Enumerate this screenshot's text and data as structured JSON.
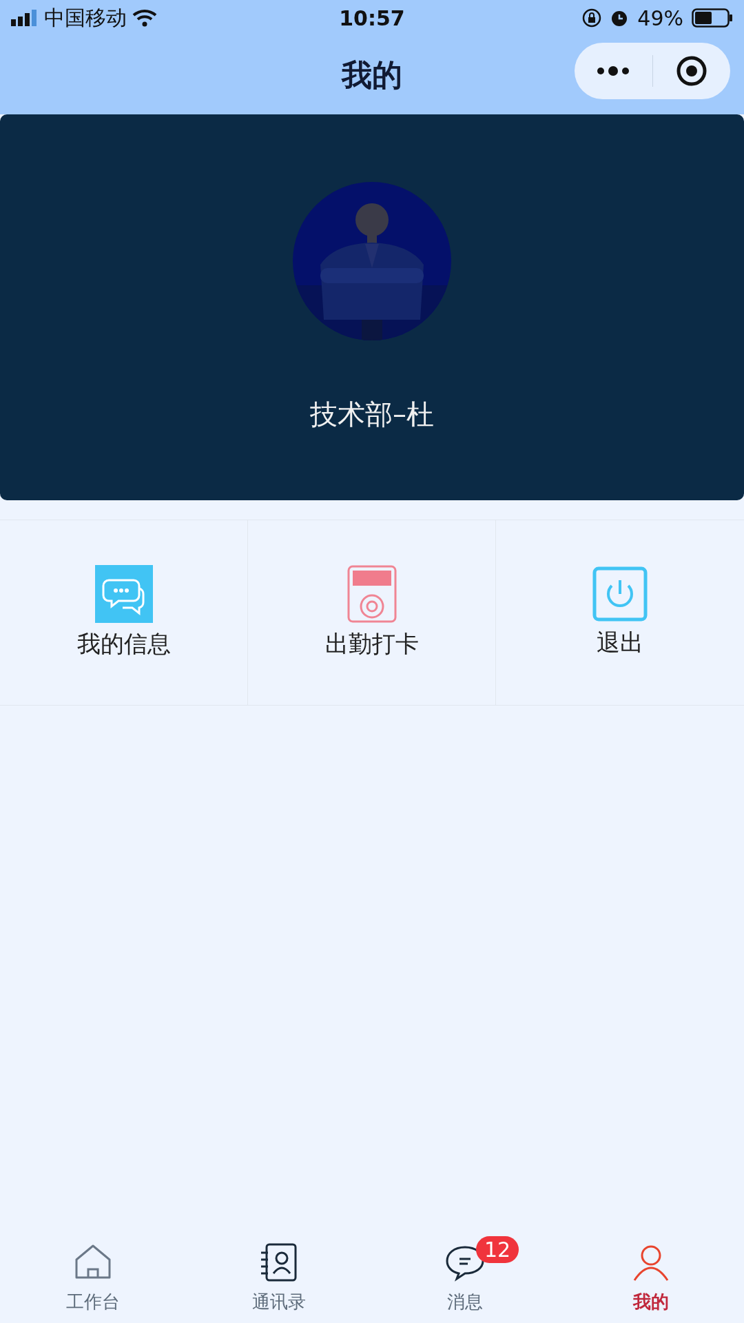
{
  "status_bar": {
    "carrier": "中国移动",
    "time": "10:57",
    "battery": "49%"
  },
  "header": {
    "title": "我的"
  },
  "profile": {
    "name": "技术部–杜"
  },
  "actions": [
    {
      "kind": "message",
      "label": "我的信息"
    },
    {
      "kind": "clock",
      "label": "出勤打卡"
    },
    {
      "kind": "logout",
      "label": "退出"
    }
  ],
  "tab_bar": [
    {
      "kind": "home",
      "label": "工作台",
      "selected": false
    },
    {
      "kind": "contacts",
      "label": "通讯录",
      "selected": false
    },
    {
      "kind": "chat",
      "label": "消息",
      "selected": false,
      "badge": "12"
    },
    {
      "kind": "user",
      "label": "我的",
      "selected": true
    }
  ]
}
